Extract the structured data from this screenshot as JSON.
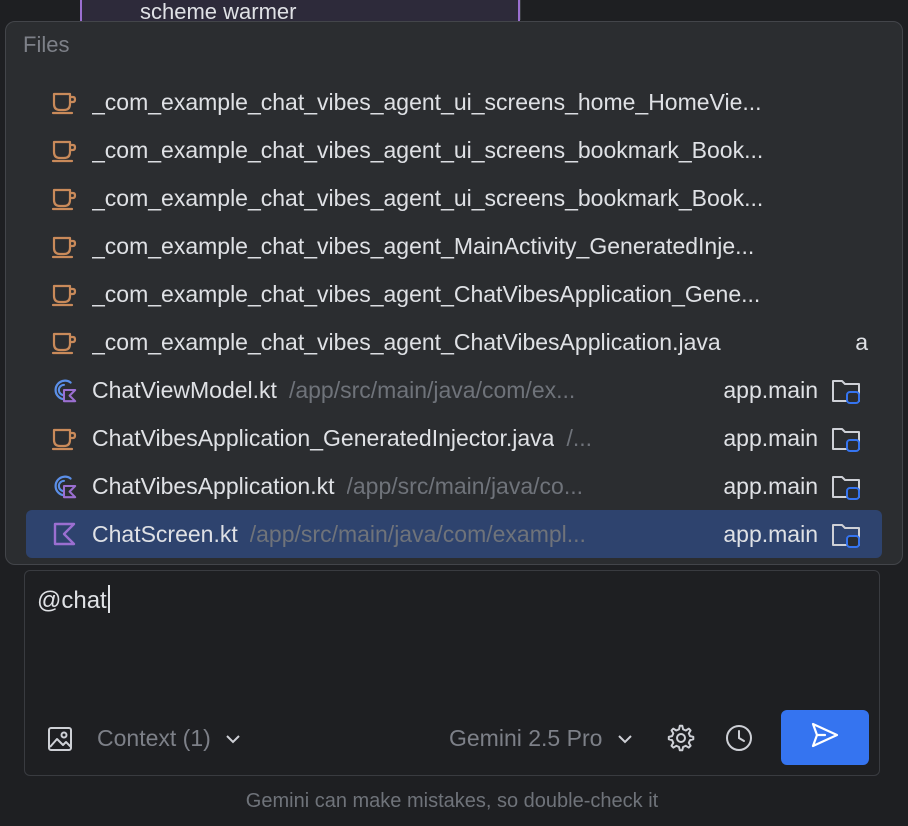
{
  "background": {
    "code_snippet": "scheme warmer"
  },
  "popup": {
    "title": "Files",
    "items": [
      {
        "icon": "java-icon",
        "name": "_com_example_chat_vibes_agent_ui_screens_home_HomeVie...",
        "path": "",
        "module": "",
        "trailing": ""
      },
      {
        "icon": "java-icon",
        "name": "_com_example_chat_vibes_agent_ui_screens_bookmark_Book...",
        "path": "",
        "module": "",
        "trailing": ""
      },
      {
        "icon": "java-icon",
        "name": "_com_example_chat_vibes_agent_ui_screens_bookmark_Book...",
        "path": "",
        "module": "",
        "trailing": ""
      },
      {
        "icon": "java-icon",
        "name": "_com_example_chat_vibes_agent_MainActivity_GeneratedInje...",
        "path": "",
        "module": "",
        "trailing": ""
      },
      {
        "icon": "java-icon",
        "name": "_com_example_chat_vibes_agent_ChatVibesApplication_Gene...",
        "path": "",
        "module": "",
        "trailing": ""
      },
      {
        "icon": "java-icon",
        "name": "_com_example_chat_vibes_agent_ChatVibesApplication.java",
        "path": "",
        "module": "",
        "trailing": "a"
      },
      {
        "icon": "kotlin-class-icon",
        "name": "ChatViewModel.kt",
        "path": "/app/src/main/java/com/ex...",
        "module": "app.main",
        "trailing": ""
      },
      {
        "icon": "java-icon",
        "name": "ChatVibesApplication_GeneratedInjector.java",
        "path": "/...",
        "module": "app.main",
        "trailing": ""
      },
      {
        "icon": "kotlin-class-icon",
        "name": "ChatVibesApplication.kt",
        "path": "/app/src/main/java/co...",
        "module": "app.main",
        "trailing": ""
      },
      {
        "icon": "kotlin-file-icon",
        "name": "ChatScreen.kt",
        "path": "/app/src/main/java/com/exampl...",
        "module": "app.main",
        "trailing": "",
        "selected": true
      }
    ]
  },
  "input": {
    "value": "@chat",
    "context_label": "Context (1)",
    "model_label": "Gemini 2.5 Pro"
  },
  "footer": {
    "disclaimer": "Gemini can make mistakes, so double-check it"
  },
  "colors": {
    "accent": "#3574f0",
    "selection": "#2e436e",
    "java_icon": "#c98a5a",
    "kotlin_icon": "#9b6fd1",
    "kotlin_class_ring": "#5b8fe8"
  }
}
